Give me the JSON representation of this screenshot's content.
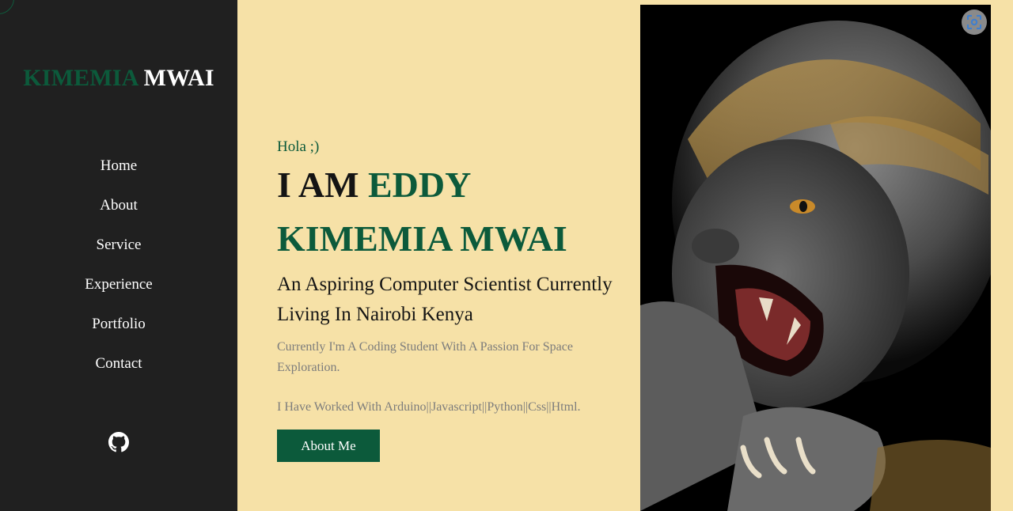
{
  "sidebar": {
    "logo_first": "KIMEMIA",
    "logo_last": "MWAI",
    "nav": [
      "Home",
      "About",
      "Service",
      "Experience",
      "Portfolio",
      "Contact"
    ],
    "social_icon": "github-icon"
  },
  "hero": {
    "greeting": "Hola ;)",
    "headline_prefix": "I AM",
    "headline_name": "EDDY KIMEMIA MWAI",
    "subtitle": "An Aspiring Computer Scientist Currently Living In Nairobi Kenya",
    "description": "Currently I'm A Coding Student With A Passion For Space Exploration.",
    "skills": "I Have Worked With Arduino||Javascript||Python||Css||Html.",
    "button_label": "About Me"
  },
  "image": {
    "icon": "image-search-icon"
  },
  "colors": {
    "accent": "#0c5a3b",
    "sidebar_bg": "#202020",
    "page_bg": "#f6e1a7",
    "muted_text": "#7c7c7c"
  }
}
